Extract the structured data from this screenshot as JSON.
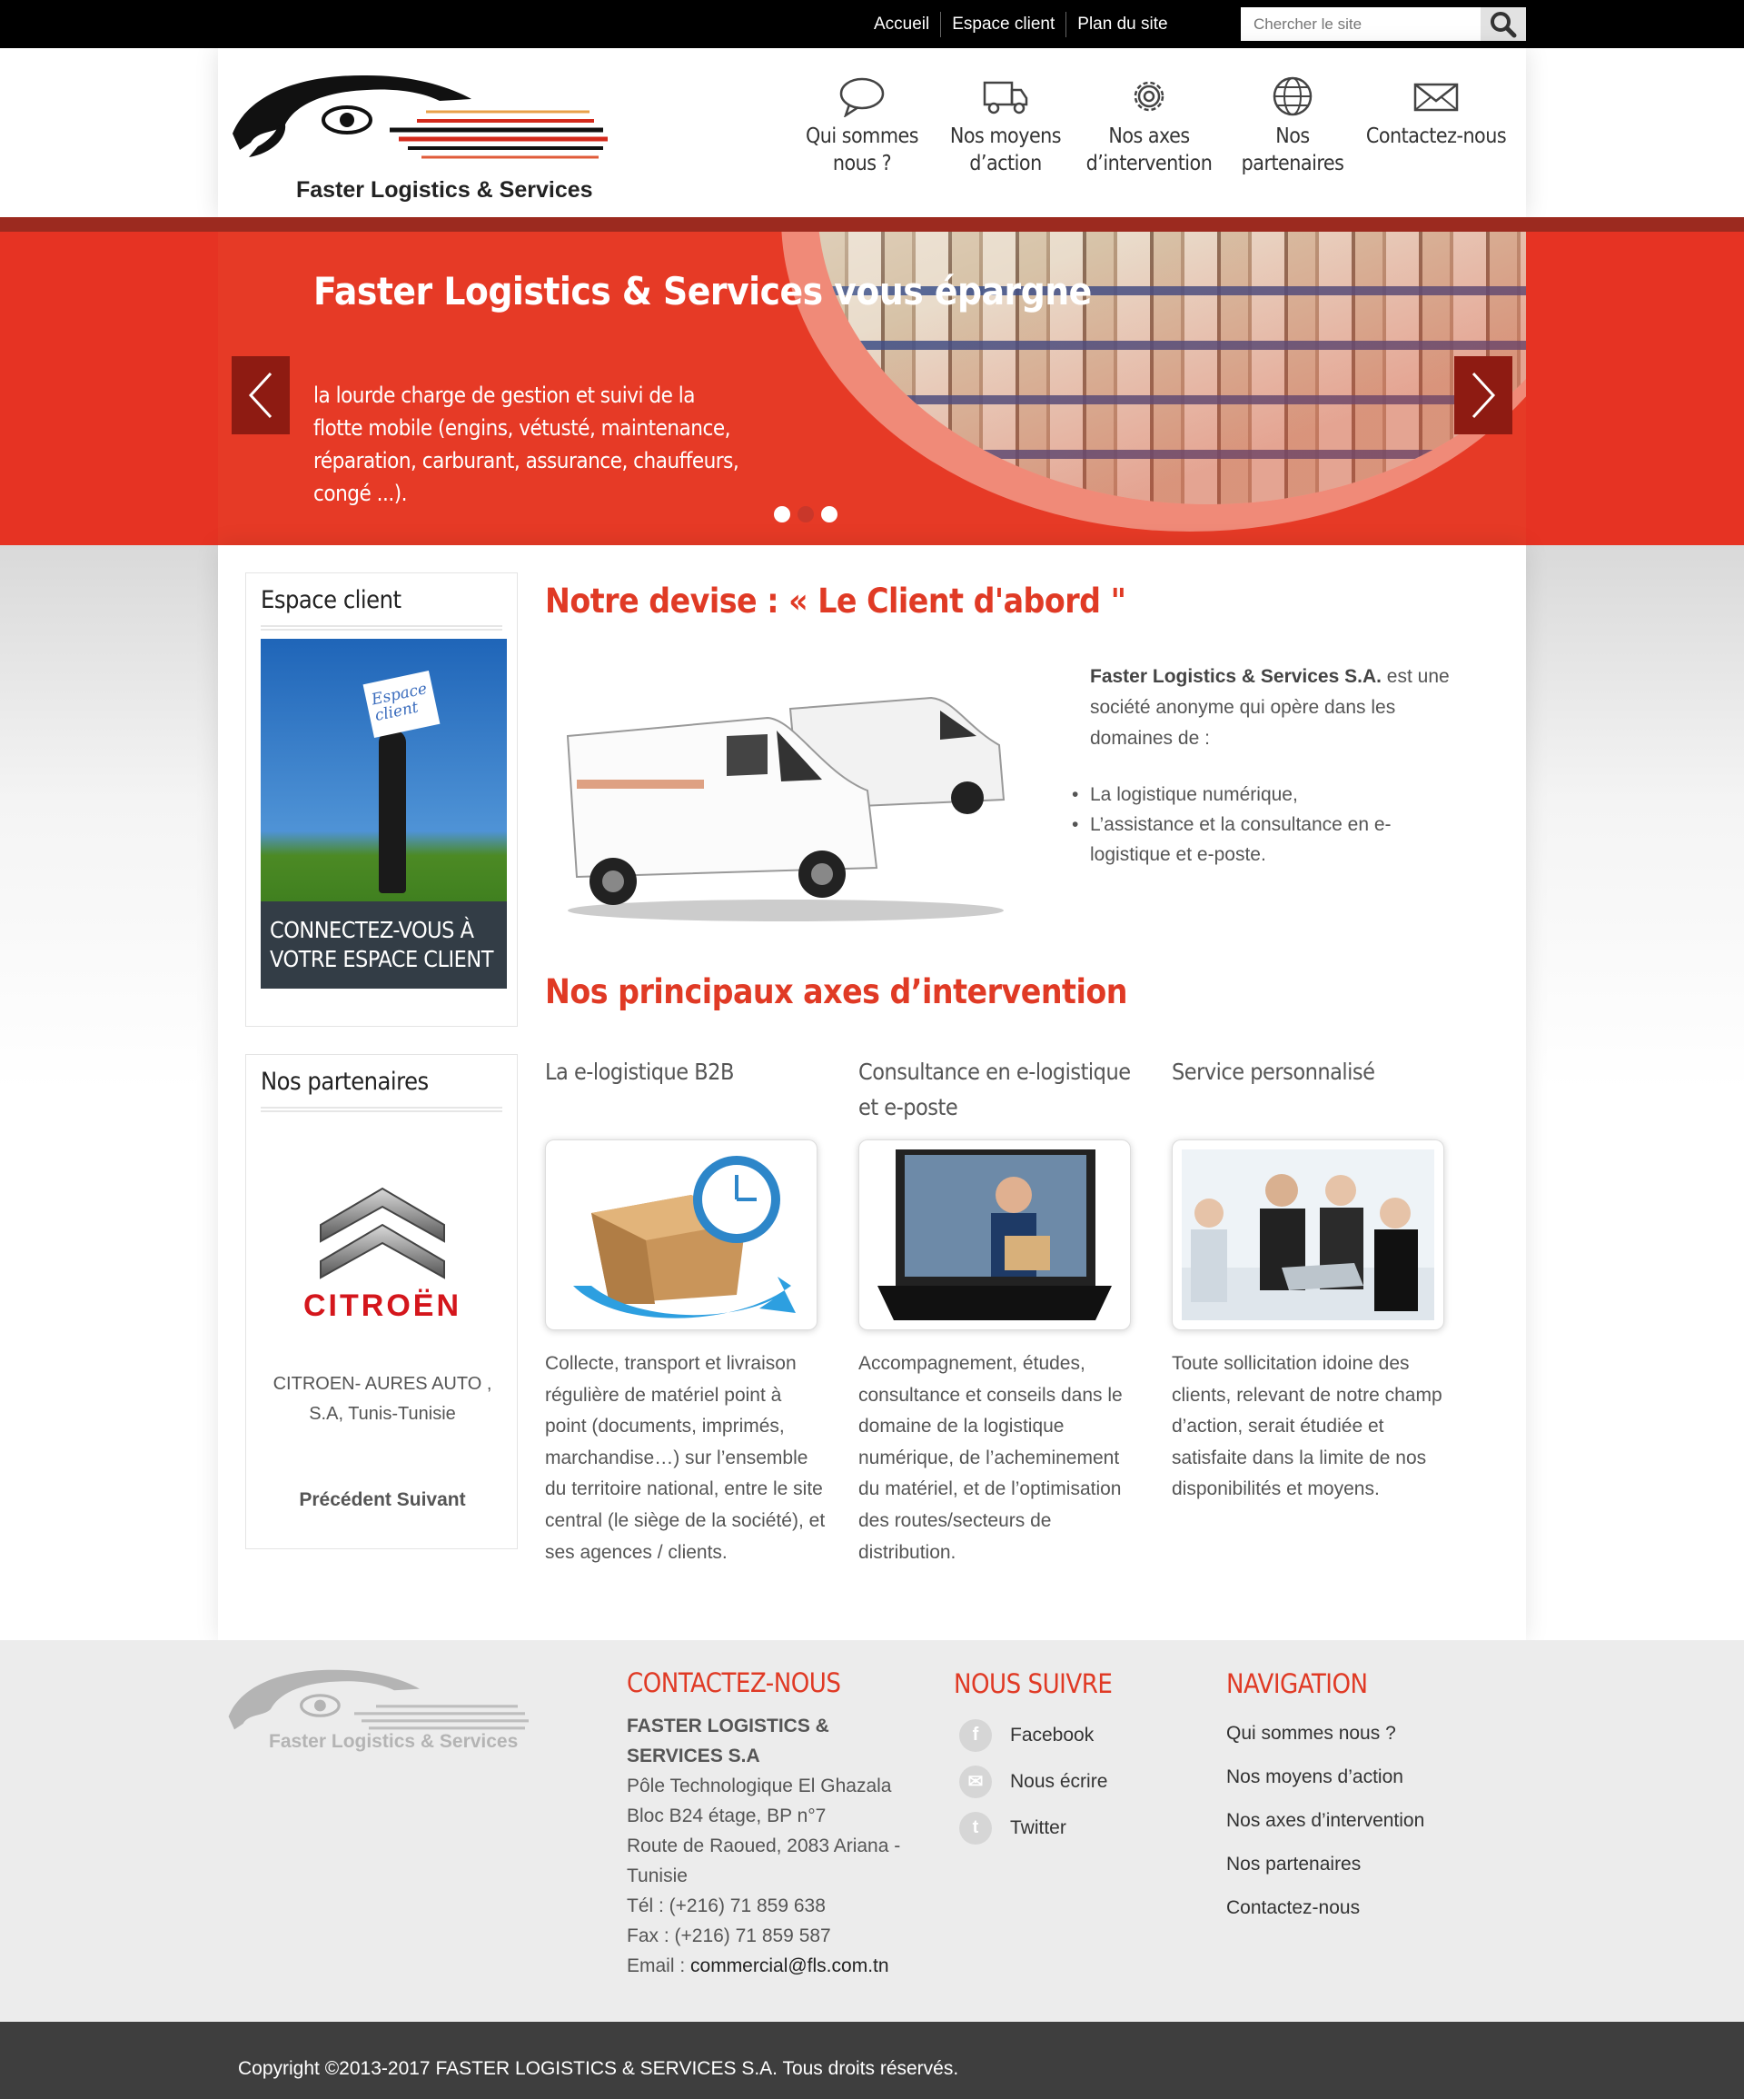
{
  "topbar": {
    "links": [
      "Accueil",
      "Espace client",
      "Plan du site"
    ],
    "search_placeholder": "Chercher le site"
  },
  "header": {
    "logo_text": "Faster Logistics & Services",
    "nav": [
      {
        "label": "Qui sommes\nnous ?",
        "icon": "speech-bubble-icon"
      },
      {
        "label": "Nos moyens\nd’action",
        "icon": "truck-icon"
      },
      {
        "label": "Nos axes\nd’intervention",
        "icon": "gear-icon"
      },
      {
        "label": "Nos\npartenaires",
        "icon": "globe-icon"
      },
      {
        "label": "Contactez-nous",
        "icon": "envelope-icon"
      }
    ]
  },
  "slider": {
    "title": "Faster Logistics & Services vous épargne",
    "text": "la lourde charge de gestion et suivi de la flotte mobile (engins, vétusté, maintenance, réparation, carburant, assurance, chauffeurs, congé ...).",
    "active_slide": 2,
    "slide_count": 3
  },
  "sidebar": {
    "espace_title": "Espace client",
    "espace_sign": "Espace client",
    "espace_banner": "CONNECTEZ-VOUS À VOTRE ESPACE CLIENT",
    "partners_title": "Nos partenaires",
    "partner_logo": "CITROËN",
    "partner_name": "CITROEN- AURES AUTO , S.A, Tunis-Tunisie",
    "prev": "Précédent",
    "next": "Suivant"
  },
  "main": {
    "devise_title": "Notre devise : « Le Client d'abord \"",
    "intro_bold": "Faster Logistics & Services S.A.",
    "intro_rest": " est une société anonyme qui opère dans les domaines de :",
    "domains": [
      "La logistique numérique,",
      "L’assistance et la consultance en e-logistique et e-poste."
    ],
    "axes_title": "Nos principaux axes d’intervention",
    "axes": [
      {
        "title": "La e-logistique B2B",
        "text": "Collecte, transport et livraison régulière de matériel point à point (documents, imprimés, marchandise…) sur l’ensemble du territoire national, entre le site central (le siège de la société), et ses agences / clients."
      },
      {
        "title": "Consultance en e-logistique et e-poste",
        "text": "Accompagnement, études, consultance et conseils dans le domaine de la logistique numérique, de l’acheminement du matériel, et de l’optimisation des routes/secteurs de distribution."
      },
      {
        "title": "Service personnalisé",
        "text": "Toute sollicitation idoine des clients, relevant de notre champ d’action, serait étudiée et satisfaite dans la limite de nos disponibilités et moyens."
      }
    ]
  },
  "footer": {
    "logo_text": "Faster Logistics & Services",
    "contact_title": "CONTACTEZ-NOUS",
    "company": "FASTER LOGISTICS & SERVICES S.A",
    "address": [
      "Pôle Technologique El Ghazala",
      "Bloc B24 étage, BP n°7",
      "Route de Raoued, 2083 Ariana - Tunisie"
    ],
    "tel": "Tél : (+216) 71 859 638",
    "fax": "Fax : (+216) 71 859 587",
    "email_label": "Email : ",
    "email": "commercial@fls.com.tn",
    "follow_title": "NOUS SUIVRE",
    "social": [
      "Facebook",
      "Nous écrire",
      "Twitter"
    ],
    "nav_title": "NAVIGATION",
    "nav": [
      "Qui sommes nous ?",
      "Nos moyens d’action",
      "Nos axes d’intervention",
      "Nos partenaires",
      "Contactez-nous"
    ]
  },
  "copyright": "Copyright ©2013-2017 FASTER LOGISTICS & SERVICES S.A. Tous droits réservés.",
  "colors": {
    "accent": "#e03a25",
    "slider_bg": "#e63a26",
    "topbar": "#000000",
    "footer_bg": "#ececec",
    "copyright_bg": "#3e3e3e"
  }
}
